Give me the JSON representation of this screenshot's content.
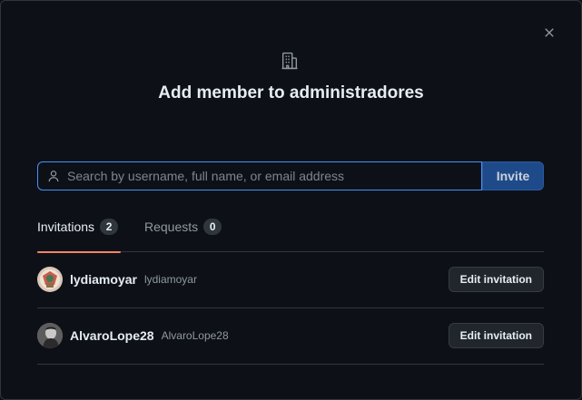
{
  "dialog": {
    "title": "Add member to administradores",
    "close_icon": "x-icon",
    "header_icon": "organization-icon"
  },
  "search": {
    "placeholder": "Search by username, full name, or email address",
    "value": "",
    "icon": "person-icon",
    "invite_label": "Invite"
  },
  "tabs": [
    {
      "label": "Invitations",
      "count": "2",
      "active": true
    },
    {
      "label": "Requests",
      "count": "0",
      "active": false
    }
  ],
  "members": [
    {
      "login": "lydiamoyar",
      "name": "lydiamoyar",
      "action_label": "Edit invitation"
    },
    {
      "login": "AlvaroLope28",
      "name": "AlvaroLope28",
      "action_label": "Edit invitation"
    }
  ],
  "colors": {
    "background": "#0d1117",
    "border": "#30363d",
    "focus_border": "#4493f8",
    "invite_button": "#1f4a8a",
    "active_tab_underline": "#f78166",
    "muted_text": "#9198a1"
  }
}
